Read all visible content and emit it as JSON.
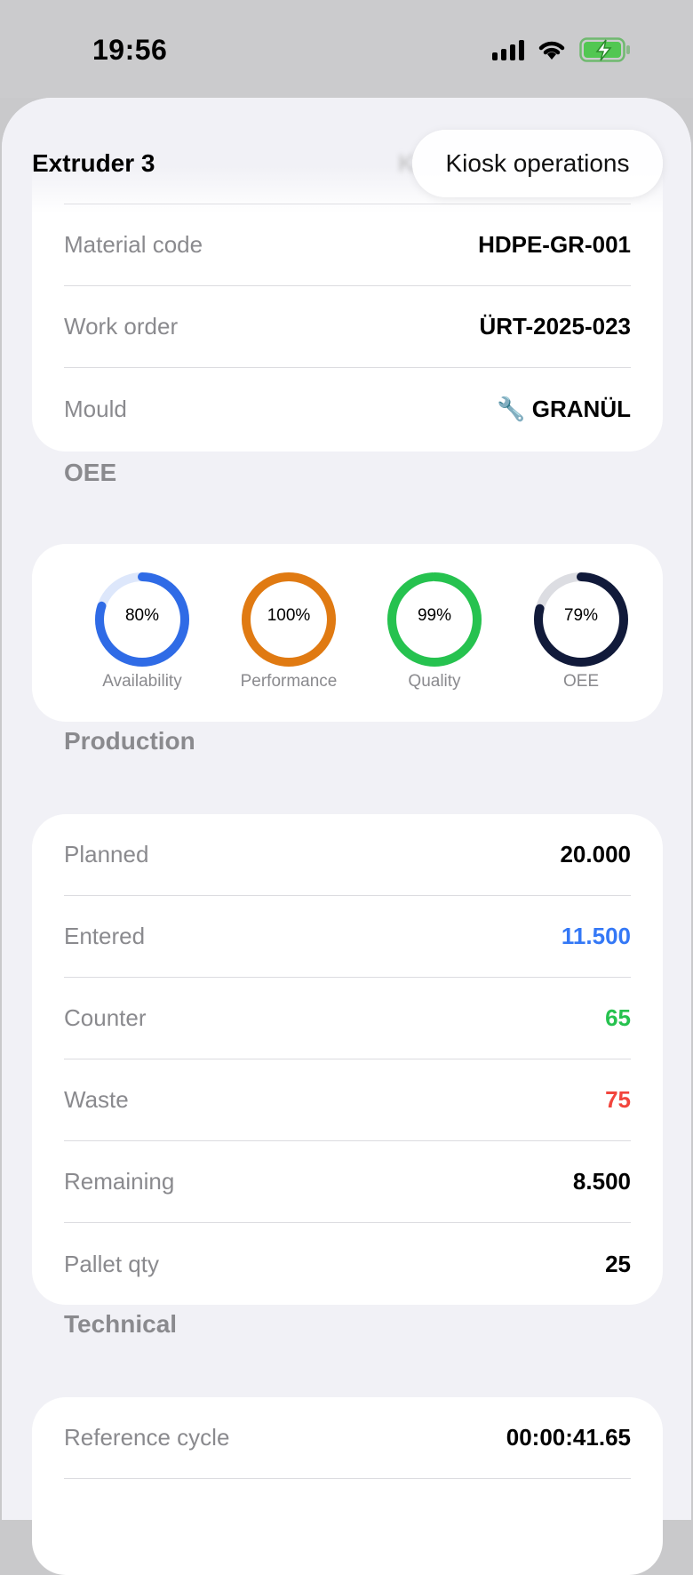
{
  "status_bar": {
    "time": "19:56"
  },
  "header": {
    "title": "Extruder 3",
    "ghost_text": "K",
    "action_label": "Kiosk operations"
  },
  "info": {
    "rows": [
      {
        "label": "Material code",
        "value": "HDPE-GR-001"
      },
      {
        "label": "Work order",
        "value": "ÜRT-2025-023"
      },
      {
        "label": "Mould",
        "value": "GRANÜL",
        "icon": "wrench-icon",
        "icon_glyph": "🔧"
      }
    ]
  },
  "oee": {
    "title": "OEE",
    "gauges": [
      {
        "label": "Availability",
        "value": "80%",
        "fraction": 0.8,
        "color": "#2f6be6",
        "track": "#dde7fb"
      },
      {
        "label": "Performance",
        "value": "100%",
        "fraction": 1.0,
        "color": "#e07a12",
        "track": "#fbe4cc"
      },
      {
        "label": "Quality",
        "value": "99%",
        "fraction": 0.99,
        "color": "#26c24f",
        "track": "#d3f2dc"
      },
      {
        "label": "OEE",
        "value": "79%",
        "fraction": 0.79,
        "color": "#111a3a",
        "track": "#dcdde2"
      }
    ]
  },
  "production": {
    "title": "Production",
    "rows": [
      {
        "label": "Planned",
        "value": "20.000",
        "color": "default"
      },
      {
        "label": "Entered",
        "value": "11.500",
        "color": "blue"
      },
      {
        "label": "Counter",
        "value": "65",
        "color": "green"
      },
      {
        "label": "Waste",
        "value": "75",
        "color": "red"
      },
      {
        "label": "Remaining",
        "value": "8.500",
        "color": "default"
      },
      {
        "label": "Pallet qty",
        "value": "25",
        "color": "default"
      }
    ]
  },
  "technical": {
    "title": "Technical",
    "rows": [
      {
        "label": "Reference cycle",
        "value": "00:00:41.65"
      }
    ]
  }
}
